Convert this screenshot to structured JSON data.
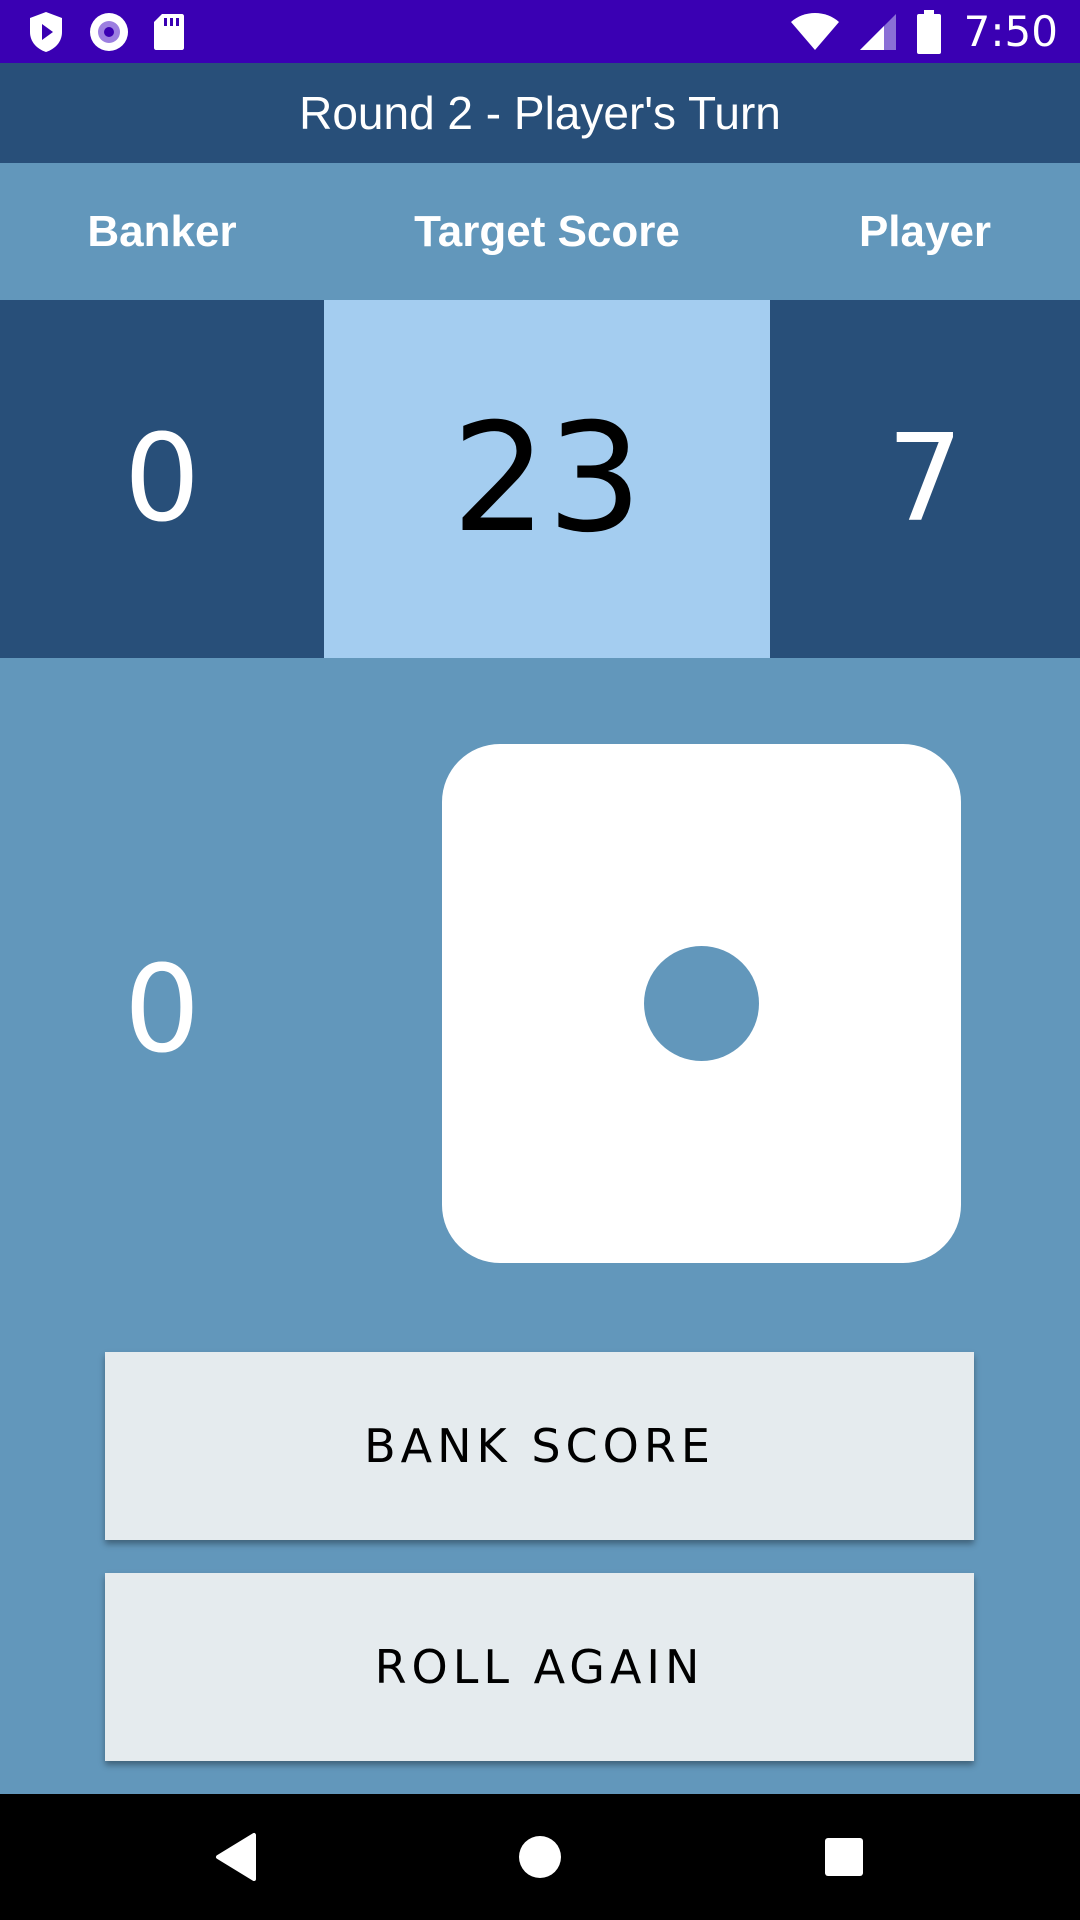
{
  "status_bar": {
    "time": "7:50",
    "left_icons": [
      "shield-play-icon",
      "record-icon",
      "sd-card-icon"
    ],
    "right_icons": [
      "wifi-icon",
      "cellular-signal-icon",
      "battery-icon"
    ],
    "background": "#3a00b3"
  },
  "app_bar": {
    "title": "Round 2 - Player's Turn",
    "background": "#284f79"
  },
  "header": {
    "banker_label": "Banker",
    "target_label": "Target Score",
    "player_label": "Player"
  },
  "scores": {
    "banker": "0",
    "target": "23",
    "player": "7"
  },
  "turn": {
    "current_turn_score": "0",
    "die_face": 1
  },
  "buttons": {
    "bank_score": "BANK SCORE",
    "roll_again": "ROLL AGAIN"
  },
  "nav_bar": {
    "icons": [
      "back-icon",
      "home-icon",
      "recents-icon"
    ]
  },
  "colors": {
    "background": "#6297bb",
    "dark_cell": "#284f79",
    "target_cell": "#a4cdf0",
    "button": "#e5ebee"
  }
}
